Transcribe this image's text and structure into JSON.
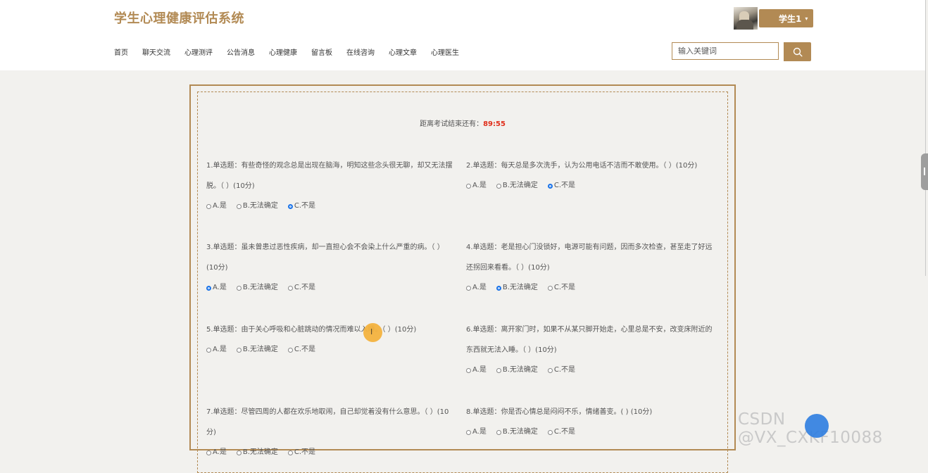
{
  "header": {
    "brand": "学生心理健康评估系统",
    "user_label": "学生1",
    "user_caret": "▾",
    "nav": [
      "首页",
      "聊天交流",
      "心理测评",
      "公告消息",
      "心理健康",
      "留言板",
      "在线咨询",
      "心理文章",
      "心理医生"
    ],
    "search_placeholder": "输入关键词"
  },
  "exam": {
    "timer_label": "距离考试结束还有：",
    "timer_value": "89:55",
    "questions": [
      {
        "text": "1.单选题：有些奇怪的观念总是出现在脑海，明知这些念头很无聊，却又无法摆脱。（ ）(10分)",
        "options": [
          "A.是",
          "B.无法确定",
          "C.不是"
        ],
        "selected": 2
      },
      {
        "text": "2.单选题：每天总是多次洗手，认为公用电话不洁而不敢使用。（ ）(10分)",
        "options": [
          "A.是",
          "B.无法确定",
          "C.不是"
        ],
        "selected": 2
      },
      {
        "text": "3.单选题：虽未曾患过恶性疾病，却一直担心会不会染上什么严重的病。（ ）(10分)",
        "options": [
          "A.是",
          "B.无法确定",
          "C.不是"
        ],
        "selected": 0
      },
      {
        "text": "4.单选题：老是担心门没锁好，电源可能有问题，因而多次检查，甚至走了好远还拐回来看看。（ ）(10分)",
        "options": [
          "A.是",
          "B.无法确定",
          "C.不是"
        ],
        "selected": 1
      },
      {
        "text": "5.单选题：由于关心呼吸和心脏跳动的情况而难以入睡。（ ）(10分)",
        "options": [
          "A.是",
          "B.无法确定",
          "C.不是"
        ],
        "selected": -1
      },
      {
        "text": "6.单选题：离开家门时，如果不从某只脚开始走，心里总是不安，改变床附近的东西就无法入睡。（ ）(10分)",
        "options": [
          "A.是",
          "B.无法确定",
          "C.不是"
        ],
        "selected": -1
      },
      {
        "text": "7.单选题：尽管四周的人都在欢乐地取闹，自己却觉着没有什么意思。（ ）(10分)",
        "options": [
          "A.是",
          "B.无法确定",
          "C.不是"
        ],
        "selected": -1
      },
      {
        "text": "8.单选题：你是否心情总是闷闷不乐，情绪善变。( ) (10分)",
        "options": [
          "A.是",
          "B.无法确定",
          "C.不是"
        ],
        "selected": -1
      }
    ]
  },
  "watermark": "CSDN @VX_CXKF10088",
  "colors": {
    "accent": "#b28a54",
    "timer": "#e02e1a",
    "radio_selected": "#1a73e8"
  }
}
